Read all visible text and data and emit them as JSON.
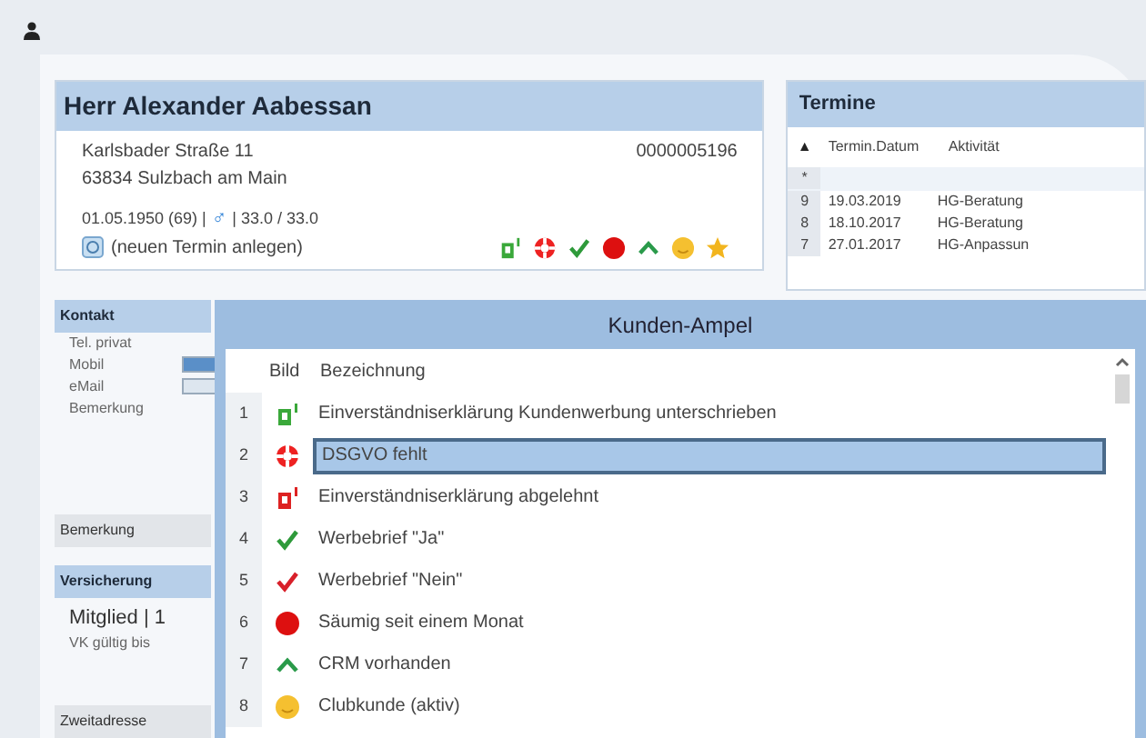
{
  "customer": {
    "name": "Herr Alexander Aabessan",
    "street": "Karlsbader Straße 11",
    "city": "63834  Sulzbach am Main",
    "number": "0000005196",
    "birth": "01.05.1950 (69) |",
    "gender_symbol": "♂",
    "values": "| 33.0 / 33.0",
    "new_appointment": "(neuen Termin anlegen)",
    "status_icons": [
      {
        "kind": "doc-green"
      },
      {
        "kind": "lifebuoy"
      },
      {
        "kind": "check-green"
      },
      {
        "kind": "dot-red"
      },
      {
        "kind": "chevron"
      },
      {
        "kind": "smiley"
      },
      {
        "kind": "star"
      }
    ]
  },
  "appointments": {
    "title": "Termine",
    "sort_symbol": "▲",
    "columns": [
      "Termin.Datum",
      "Aktivität"
    ],
    "new_row_symbol": "*",
    "rows": [
      {
        "number": "9",
        "date": "19.03.2019",
        "activity": "HG-Beratung"
      },
      {
        "number": "8",
        "date": "18.10.2017",
        "activity": "HG-Beratung"
      },
      {
        "number": "7",
        "date": "27.01.2017",
        "activity": "HG-Anpassun"
      }
    ]
  },
  "sidebar": [
    {
      "title": "Kontakt",
      "active": true,
      "items": [
        "Tel. privat",
        "Mobil",
        "eMail",
        "Bemerkung"
      ]
    },
    {
      "title": "Bemerkung",
      "active": false
    },
    {
      "title": "Versicherung",
      "active": true,
      "items": [
        "Mitglied | 1",
        "VK gültig bis"
      ]
    },
    {
      "title": "Zweitadresse",
      "active": false
    }
  ],
  "dialog": {
    "title": "Kunden-Ampel",
    "columns": [
      "Bild",
      "Bezeichnung"
    ],
    "rows": [
      {
        "number": "1",
        "kind": "doc-green",
        "label": "Einverständniserklärung Kundenwerbung unterschrieben",
        "selected": false
      },
      {
        "number": "2",
        "kind": "lifebuoy",
        "label": "DSGVO fehlt",
        "selected": true
      },
      {
        "number": "3",
        "kind": "doc-red",
        "label": "Einverständniserklärung abgelehnt",
        "selected": false
      },
      {
        "number": "4",
        "kind": "check-green",
        "label": "Werbebrief \"Ja\"",
        "selected": false
      },
      {
        "number": "5",
        "kind": "check-red",
        "label": "Werbebrief \"Nein\"",
        "selected": false
      },
      {
        "number": "6",
        "kind": "dot-red",
        "label": "Säumig seit einem Monat",
        "selected": false
      },
      {
        "number": "7",
        "kind": "chevron",
        "label": "CRM vorhanden",
        "selected": false
      },
      {
        "number": "8",
        "kind": "smiley",
        "label": "Clubkunde (aktiv)",
        "selected": false
      }
    ]
  }
}
